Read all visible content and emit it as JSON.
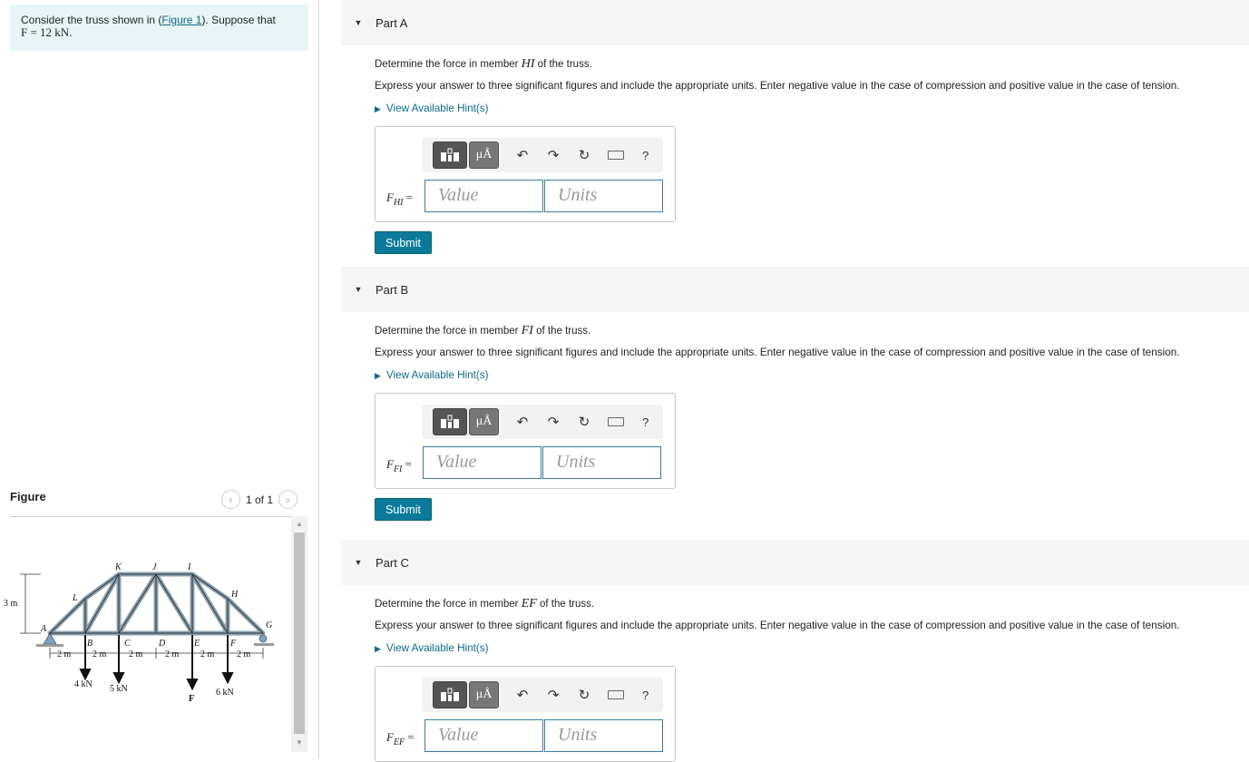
{
  "problem": {
    "text_before": "Consider the truss shown in (",
    "figure_link": "Figure 1",
    "text_after": "). Suppose that",
    "given": "F = 12 kN."
  },
  "figure": {
    "heading": "Figure",
    "pager": "1 of 1",
    "joint_labels": [
      "A",
      "B",
      "C",
      "D",
      "E",
      "F",
      "G",
      "H",
      "I",
      "J",
      "K",
      "L"
    ],
    "height_label": "3 m",
    "spacing_label": "2 m",
    "loads": [
      "4 kN",
      "5 kN",
      "F",
      "6 kN"
    ]
  },
  "parts": [
    {
      "title": "Part A",
      "q_pre": "Determine the force in member ",
      "member": "HI",
      "q_post": " of the truss.",
      "instructions": "Express your answer to three significant figures and include the appropriate units. Enter negative value in the case of compression and positive value in the case of tension.",
      "hint": "View Available Hint(s)",
      "var": "F",
      "sub": "HI",
      "value_ph": "Value",
      "units_ph": "Units",
      "submit": "Submit"
    },
    {
      "title": "Part B",
      "q_pre": "Determine the force in member ",
      "member": "FI",
      "q_post": " of the truss.",
      "instructions": "Express your answer to three significant figures and include the appropriate units. Enter negative value in the case of compression and positive value in the case of tension.",
      "hint": "View Available Hint(s)",
      "var": "F",
      "sub": "FI",
      "value_ph": "Value",
      "units_ph": "Units",
      "submit": "Submit"
    },
    {
      "title": "Part C",
      "q_pre": "Determine the force in member ",
      "member": "EF",
      "q_post": " of the truss.",
      "instructions": "Express your answer to three significant figures and include the appropriate units. Enter negative value in the case of compression and positive value in the case of tension.",
      "hint": "View Available Hint(s)",
      "var": "F",
      "sub": "EF",
      "value_ph": "Value",
      "units_ph": "Units",
      "submit": "Submit"
    }
  ],
  "toolbar": {
    "mu_label": "μÅ",
    "help": "?",
    "icons": [
      "templates-icon",
      "units-icon",
      "undo-icon",
      "redo-icon",
      "reset-icon",
      "keyboard-icon",
      "help-icon"
    ]
  }
}
